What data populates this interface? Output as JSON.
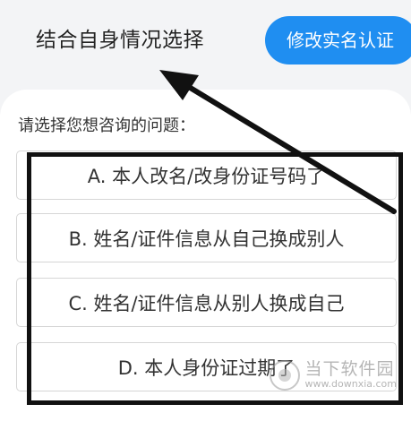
{
  "header": {
    "title": "结合自身情况选择",
    "modify_button": "修改实名认证"
  },
  "question": {
    "prompt": "请选择您想咨询的问题："
  },
  "options": [
    {
      "label": "A. 本人改名/改身份证号码了"
    },
    {
      "label": "B. 姓名/证件信息从自己换成别人"
    },
    {
      "label": "C. 姓名/证件信息从别人换成自己"
    },
    {
      "label": "D. 本人身份证过期了"
    }
  ],
  "watermark": {
    "name": "当下软件园",
    "url": "www.downxia.com"
  },
  "annotation_color": "#111111",
  "accent_color": "#1f8ef1"
}
